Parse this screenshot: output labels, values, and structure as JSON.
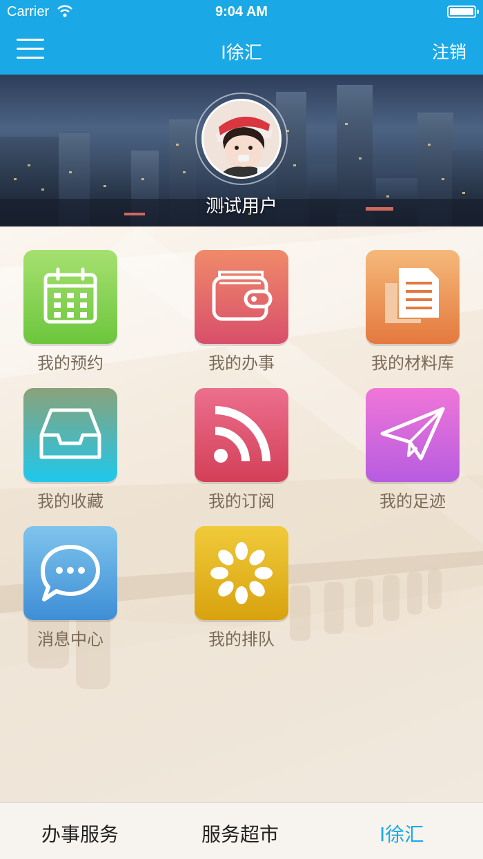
{
  "status_bar": {
    "carrier": "Carrier",
    "time": "9:04 AM"
  },
  "nav": {
    "title": "I徐汇",
    "logout_label": "注销"
  },
  "profile": {
    "user_name": "测试用户"
  },
  "tiles": [
    {
      "label": "我的预约",
      "icon": "calendar-icon",
      "color_top": "#a6e070",
      "color_bottom": "#6cc63c"
    },
    {
      "label": "我的办事",
      "icon": "wallet-icon",
      "color_top": "#f08a6a",
      "color_bottom": "#d84f6a"
    },
    {
      "label": "我的材料库",
      "icon": "document-icon",
      "color_top": "#f5b97a",
      "color_bottom": "#e4793e"
    },
    {
      "label": "我的收藏",
      "icon": "inbox-tray-icon",
      "color_top": "#8aa27a",
      "color_bottom": "#1ec8ec"
    },
    {
      "label": "我的订阅",
      "icon": "rss-icon",
      "color_top": "#ec6f8e",
      "color_bottom": "#d33f57"
    },
    {
      "label": "我的足迹",
      "icon": "paper-plane-icon",
      "color_top": "#f176d8",
      "color_bottom": "#b65ce0"
    },
    {
      "label": "消息中心",
      "icon": "chat-bubble-icon",
      "color_top": "#7ec4ec",
      "color_bottom": "#3e8ed6"
    },
    {
      "label": "我的排队",
      "icon": "queue-burst-icon",
      "color_top": "#f0ca3a",
      "color_bottom": "#d8a20e"
    }
  ],
  "tabbar": {
    "items": [
      {
        "label": "办事服务"
      },
      {
        "label": "服务超市"
      },
      {
        "label": "I徐汇"
      }
    ],
    "active_color": "#1aa9e6"
  },
  "colors": {
    "primary": "#1aa9e6",
    "tile_label": "#7a6a58"
  }
}
